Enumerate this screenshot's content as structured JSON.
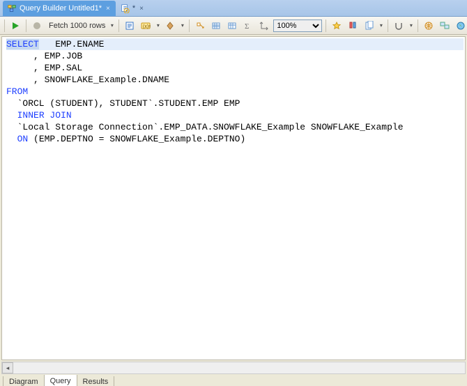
{
  "tabs": [
    {
      "title": "Query Builder Untitled1*",
      "active": true
    },
    {
      "title": "*",
      "active": false
    }
  ],
  "toolbar": {
    "fetch_label": "Fetch 1000 rows",
    "zoom_value": "100%"
  },
  "sql": {
    "tokens": [
      {
        "t": "SELECT",
        "cls": "kw sel-highlight"
      },
      {
        "t": "   EMP.ENAME"
      },
      {
        "br": true
      },
      {
        "t": "     , EMP.JOB"
      },
      {
        "br": true
      },
      {
        "t": "     , EMP.SAL"
      },
      {
        "br": true
      },
      {
        "t": "     , SNOWFLAKE_Example.DNAME"
      },
      {
        "br": true
      },
      {
        "t": "FROM",
        "cls": "kw"
      },
      {
        "br": true
      },
      {
        "t": "  `ORCL (STUDENT), STUDENT`.STUDENT.EMP EMP"
      },
      {
        "br": true
      },
      {
        "t": "  "
      },
      {
        "t": "INNER JOIN",
        "cls": "kw"
      },
      {
        "br": true
      },
      {
        "t": "  `Local Storage Connection`.EMP_DATA.SNOWFLAKE_Example SNOWFLAKE_Example"
      },
      {
        "br": true
      },
      {
        "t": "  "
      },
      {
        "t": "ON",
        "cls": "kw"
      },
      {
        "t": " (EMP.DEPTNO = SNOWFLAKE_Example.DEPTNO)"
      }
    ]
  },
  "bottom_tabs": {
    "diagram": "Diagram",
    "query": "Query",
    "results": "Results",
    "active": "query"
  }
}
